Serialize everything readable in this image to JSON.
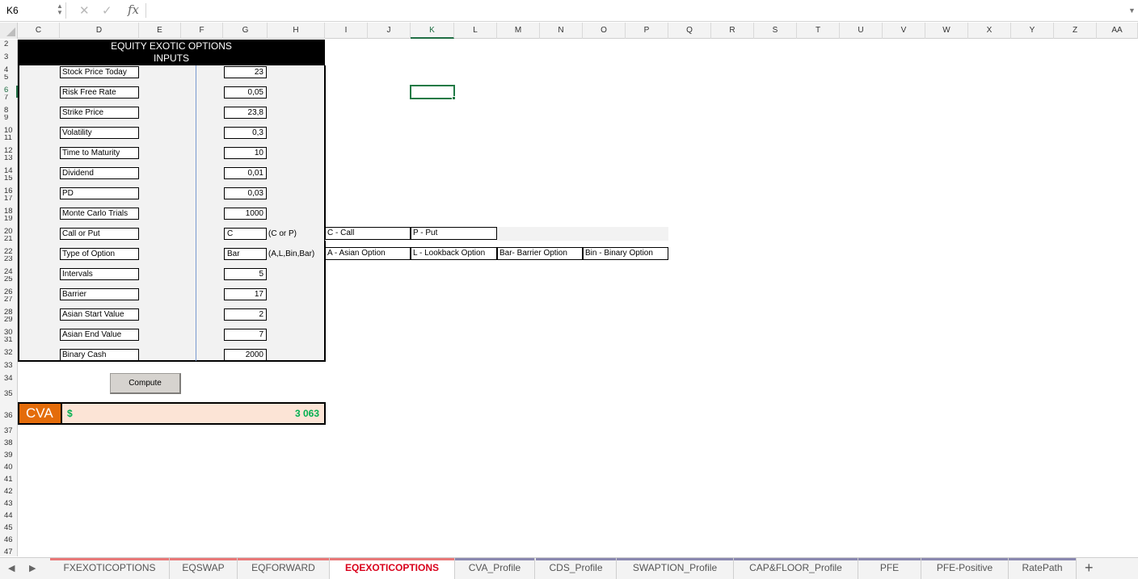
{
  "formula_bar": {
    "name_box": "K6",
    "cancel_glyph": "✕",
    "enter_glyph": "✓",
    "fx_label": "fx",
    "formula": ""
  },
  "columns": [
    "C",
    "D",
    "E",
    "F",
    "G",
    "H",
    "I",
    "J",
    "K",
    "L",
    "M",
    "N",
    "O",
    "P",
    "Q",
    "R",
    "S",
    "T",
    "U",
    "V",
    "W",
    "X",
    "Y",
    "Z",
    "AA"
  ],
  "active_column": "K",
  "rows": [
    "2",
    "3",
    "4",
    "5",
    "6",
    "7",
    "8",
    "9",
    "10",
    "11",
    "12",
    "13",
    "14",
    "15",
    "16",
    "17",
    "18",
    "19",
    "20",
    "21",
    "22",
    "23",
    "24",
    "25",
    "26",
    "27",
    "28",
    "29",
    "30",
    "31",
    "32",
    "33",
    "34",
    "35",
    "36",
    "37",
    "38",
    "39",
    "40",
    "41",
    "42",
    "43",
    "44",
    "45",
    "46",
    "47"
  ],
  "active_row": "6",
  "panel": {
    "title": "EQUITY EXOTIC OPTIONS",
    "subtitle": "INPUTS",
    "inputs": [
      {
        "label": "Stock Price Today",
        "value": "23"
      },
      {
        "label": "Risk Free Rate",
        "value": "0,05"
      },
      {
        "label": "Strike Price",
        "value": "23,8"
      },
      {
        "label": "Volatility",
        "value": "0,3"
      },
      {
        "label": "Time to Maturity",
        "value": "10"
      },
      {
        "label": "Dividend",
        "value": "0,01"
      },
      {
        "label": "PD",
        "value": "0,03"
      },
      {
        "label": "Monte Carlo Trials",
        "value": "1000"
      },
      {
        "label": "Call or Put",
        "value": "C"
      },
      {
        "label": "Type of Option",
        "value": "Bar"
      },
      {
        "label": "Intervals",
        "value": "5"
      },
      {
        "label": "Barrier",
        "value": "17"
      },
      {
        "label": "Asian Start Value",
        "value": "2"
      },
      {
        "label": "Asian End Value",
        "value": "7"
      },
      {
        "label": "Binary Cash",
        "value": "2000"
      }
    ],
    "hint_call_put": "(C or P)",
    "hint_type": "(A,L,Bin,Bar)"
  },
  "call_put_legend": [
    "C - Call",
    "P - Put"
  ],
  "option_type_legend": [
    "A - Asian Option",
    "L - Lookback Option",
    "Bar- Barrier Option",
    "Bin - Binary Option"
  ],
  "compute_button": "Compute",
  "cva": {
    "label": "CVA",
    "currency": "$",
    "value": "3 063"
  },
  "sheet_tabs": [
    {
      "label": "FXEXOTICOPTIONS",
      "color": "#e87878"
    },
    {
      "label": "EQSWAP",
      "color": "#e87878"
    },
    {
      "label": "EQFORWARD",
      "color": "#e87878"
    },
    {
      "label": "EQEXOTICOPTIONS",
      "color": "#e87878"
    },
    {
      "label": "CVA_Profile",
      "color": "#8a88b0"
    },
    {
      "label": "CDS_Profile",
      "color": "#8a88b0"
    },
    {
      "label": "SWAPTION_Profile",
      "color": "#8a88b0"
    },
    {
      "label": "CAP&FLOOR_Profile",
      "color": "#8a88b0"
    },
    {
      "label": "PFE",
      "color": "#8a88b0"
    },
    {
      "label": "PFE-Positive",
      "color": "#8a88b0"
    },
    {
      "label": "RatePath",
      "color": "#8a88b0"
    }
  ],
  "active_tab": "EQEXOTICOPTIONS",
  "add_sheet": "+"
}
